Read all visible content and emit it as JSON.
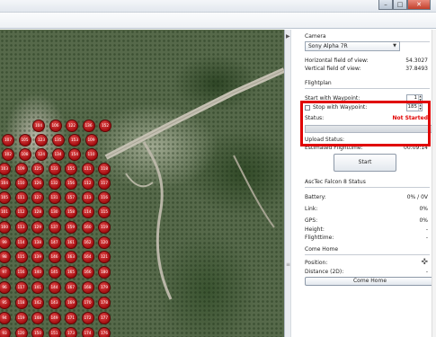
{
  "window": {
    "minimize_icon": "minimize-icon",
    "maximize_icon": "maximize-icon",
    "close_icon": "close-icon"
  },
  "map": {
    "waypoints": [
      "104",
      "106",
      "122",
      "136",
      "152",
      "107",
      "105",
      "123",
      "135",
      "153",
      "109",
      "102",
      "108",
      "124",
      "134",
      "154",
      "110",
      "103",
      "109",
      "125",
      "133",
      "155",
      "111",
      "118",
      "104",
      "110",
      "126",
      "132",
      "156",
      "112",
      "117",
      "105",
      "111",
      "127",
      "131",
      "157",
      "113",
      "116",
      "101",
      "112",
      "128",
      "130",
      "158",
      "114",
      "115",
      "100",
      "113",
      "129",
      "137",
      "159",
      "160",
      "119",
      "99",
      "114",
      "138",
      "147",
      "161",
      "162",
      "120",
      "98",
      "115",
      "139",
      "146",
      "163",
      "164",
      "121",
      "97",
      "116",
      "140",
      "145",
      "165",
      "166",
      "180",
      "96",
      "117",
      "141",
      "144",
      "167",
      "168",
      "179",
      "95",
      "118",
      "142",
      "143",
      "169",
      "170",
      "178",
      "94",
      "119",
      "148",
      "149",
      "171",
      "172",
      "177",
      "93",
      "120",
      "150",
      "151",
      "173",
      "174",
      "176"
    ]
  },
  "camera": {
    "section_label": "Camera",
    "selected": "Sony Alpha 7R",
    "hfov_label": "Horizontal field of view:",
    "hfov_value": "54.3027",
    "vfov_label": "Vertical field of view:",
    "vfov_value": "37.8493"
  },
  "flightplan": {
    "section_label": "Flightplan",
    "start_label": "Start with Waypoint:",
    "start_value": "1",
    "stop_label": "Stop with Waypoint:",
    "stop_value": "185",
    "status_label": "Status:",
    "status_value": "Not Started",
    "status_color": "#e00000",
    "upload_label": "Upload Status:",
    "upload_progress": 0,
    "flighttime_label": "Estimated Flighttime:",
    "flighttime_value": "00:09:14",
    "start_button": "Start"
  },
  "status": {
    "section_label": "AscTec Falcon 8 Status",
    "battery_label": "Battery:",
    "battery_value": "0% / 0V",
    "link_label": "Link:",
    "link_value": "0%",
    "gps_label": "GPS:",
    "gps_value": "0%",
    "height_label": "Height:",
    "height_value": "-",
    "flighttime_label": "Flighttime:",
    "flighttime_value": "-"
  },
  "come_home": {
    "section_label": "Come Home",
    "position_label": "Position:",
    "position_icon": "crosshair-icon",
    "distance_label": "Distance (2D):",
    "distance_value": "-",
    "button": "Come Home"
  }
}
